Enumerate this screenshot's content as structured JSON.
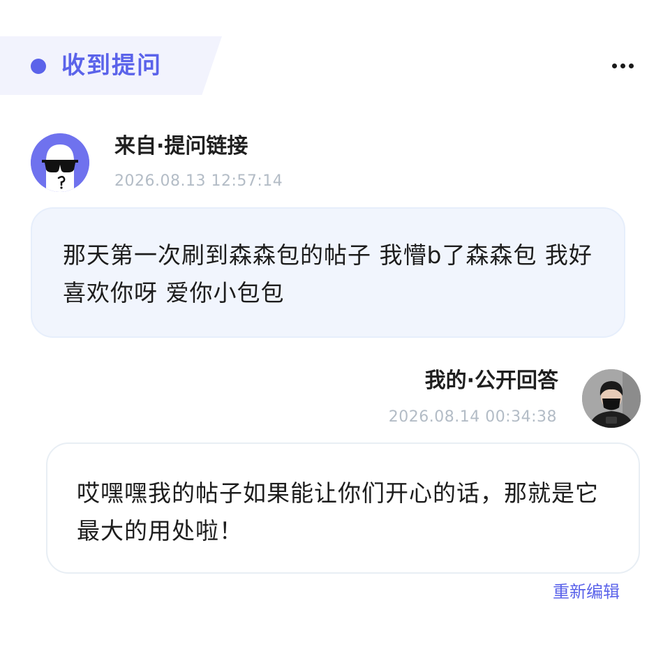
{
  "header": {
    "title": "收到提问",
    "more_icon": "more-horizontal-icon",
    "accent_color": "#5b63ea"
  },
  "question": {
    "author_label": "来自·提问链接",
    "timestamp": "2026.08.13 12:57:14",
    "avatar_icon": "sunglasses-character-avatar",
    "text": "那天第一次刷到森森包的帖子 我懵b了森森包 我好喜欢你呀 爱你小包包"
  },
  "answer": {
    "author_label": "我的·公开回答",
    "timestamp": "2026.08.14 00:34:38",
    "avatar_icon": "user-photo-avatar",
    "text": "哎嘿嘿我的帖子如果能让你们开心的话，那就是它最大的用处啦！",
    "reedit_label": "重新编辑"
  }
}
